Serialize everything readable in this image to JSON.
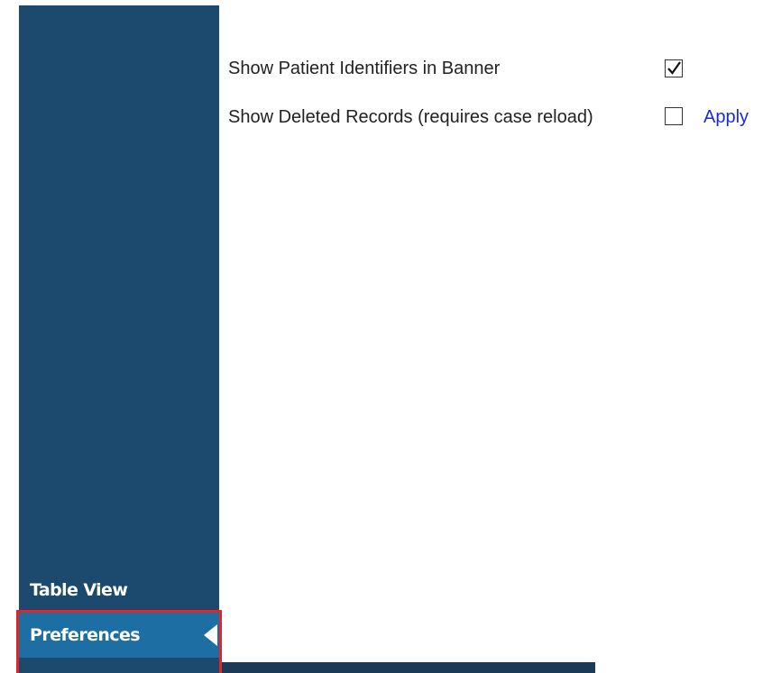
{
  "settings": {
    "show_patient_identifiers": {
      "label": "Show Patient Identifiers in Banner",
      "checked": true
    },
    "show_deleted_records": {
      "label": "Show Deleted Records (requires case reload)",
      "checked": false,
      "apply_label": "Apply"
    }
  },
  "sidebar": {
    "items": [
      {
        "label": "Table View"
      },
      {
        "label": "Preferences"
      }
    ]
  },
  "colors": {
    "sidebar_bg": "#1b4a6e",
    "selected_bg": "#1c6ea3",
    "highlight_border": "#e0262b",
    "link": "#1a2bd6"
  }
}
